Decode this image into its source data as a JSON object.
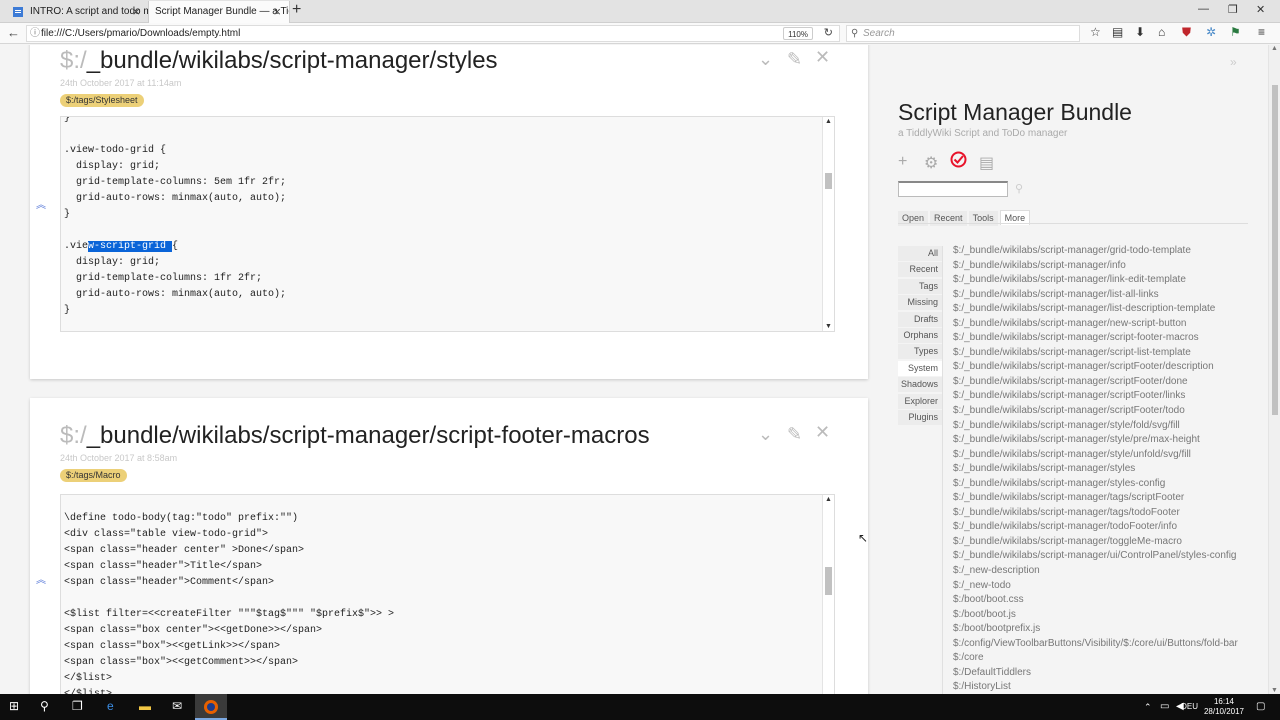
{
  "browser": {
    "tabs": [
      {
        "title": "INTRO: A script and todo m"
      },
      {
        "title": "Script Manager Bundle — a Tidd"
      }
    ],
    "url": "file:///C:/Users/pmario/Downloads/empty.html",
    "zoom": "110%",
    "search_placeholder": "Search"
  },
  "tiddlers": [
    {
      "prefix": "$:/",
      "title": "_bundle/wikilabs/script-manager/styles",
      "date": "24th October 2017 at 11:14am",
      "tag": "$:/tags/Stylesheet",
      "code_pre": "}\n\n.view-todo-grid {\n  display: grid;\n  grid-template-columns: 5em 1fr 2fr;\n  grid-auto-rows: minmax(auto, auto);\n}\n\n.vie",
      "code_sel": "w-script-grid ",
      "code_post": "{\n  display: grid;\n  grid-template-columns: 1fr 2fr;\n  grid-auto-rows: minmax(auto, auto);\n}"
    },
    {
      "prefix": "$:/",
      "title": "_bundle/wikilabs/script-manager/script-footer-macros",
      "date": "24th October 2017 at 8:58am",
      "tag": "$:/tags/Macro",
      "code": "\n\\define todo-body(tag:\"todo\" prefix:\"\")\n<div class=\"table view-todo-grid\">\n<span class=\"header center\" >Done</span>\n<span class=\"header\">Title</span>\n<span class=\"header\">Comment</span>\n\n<$list filter=<<createFilter \"\"\"$tag$\"\"\" \"$prefix$\">> >\n<span class=\"box center\"><<getDone>></span>\n<span class=\"box\"><<getLink>></span>\n<span class=\"box\"><<getComment>></span>\n</$list>\n</$list>"
    }
  ],
  "sidebar": {
    "title": "Script Manager Bundle",
    "subtitle": "a TiddlyWiki Script and ToDo manager",
    "tabs": [
      "Open",
      "Recent",
      "Tools",
      "More"
    ],
    "more_tabs": [
      "All",
      "Recent",
      "Tags",
      "Missing",
      "Drafts",
      "Orphans",
      "Types",
      "System",
      "Shadows",
      "Explorer",
      "Plugins"
    ],
    "list": [
      "$:/_bundle/wikilabs/script-manager/grid-todo-template",
      "$:/_bundle/wikilabs/script-manager/info",
      "$:/_bundle/wikilabs/script-manager/link-edit-template",
      "$:/_bundle/wikilabs/script-manager/list-all-links",
      "$:/_bundle/wikilabs/script-manager/list-description-template",
      "$:/_bundle/wikilabs/script-manager/new-script-button",
      "$:/_bundle/wikilabs/script-manager/script-footer-macros",
      "$:/_bundle/wikilabs/script-manager/script-list-template",
      "$:/_bundle/wikilabs/script-manager/scriptFooter/description",
      "$:/_bundle/wikilabs/script-manager/scriptFooter/done",
      "$:/_bundle/wikilabs/script-manager/scriptFooter/links",
      "$:/_bundle/wikilabs/script-manager/scriptFooter/todo",
      "$:/_bundle/wikilabs/script-manager/style/fold/svg/fill",
      "$:/_bundle/wikilabs/script-manager/style/pre/max-height",
      "$:/_bundle/wikilabs/script-manager/style/unfold/svg/fill",
      "$:/_bundle/wikilabs/script-manager/styles",
      "$:/_bundle/wikilabs/script-manager/styles-config",
      "$:/_bundle/wikilabs/script-manager/tags/scriptFooter",
      "$:/_bundle/wikilabs/script-manager/tags/todoFooter",
      "$:/_bundle/wikilabs/script-manager/todoFooter/info",
      "$:/_bundle/wikilabs/script-manager/toggleMe-macro",
      "$:/_bundle/wikilabs/script-manager/ui/ControlPanel/styles-config",
      "$:/_new-description",
      "$:/_new-todo",
      "$:/boot/boot.css",
      "$:/boot/boot.js",
      "$:/boot/bootprefix.js",
      "$:/config/ViewToolbarButtons/Visibility/$:/core/ui/Buttons/fold-bar",
      "$:/core",
      "$:/DefaultTiddlers",
      "$:/HistoryList"
    ]
  },
  "taskbar": {
    "lang": "DEU",
    "time": "16:14",
    "date": "28/10/2017"
  },
  "colors": {
    "tag_bg": "#ecd078",
    "selection": "#0a64d8",
    "todo_icon": "#e8132a"
  }
}
